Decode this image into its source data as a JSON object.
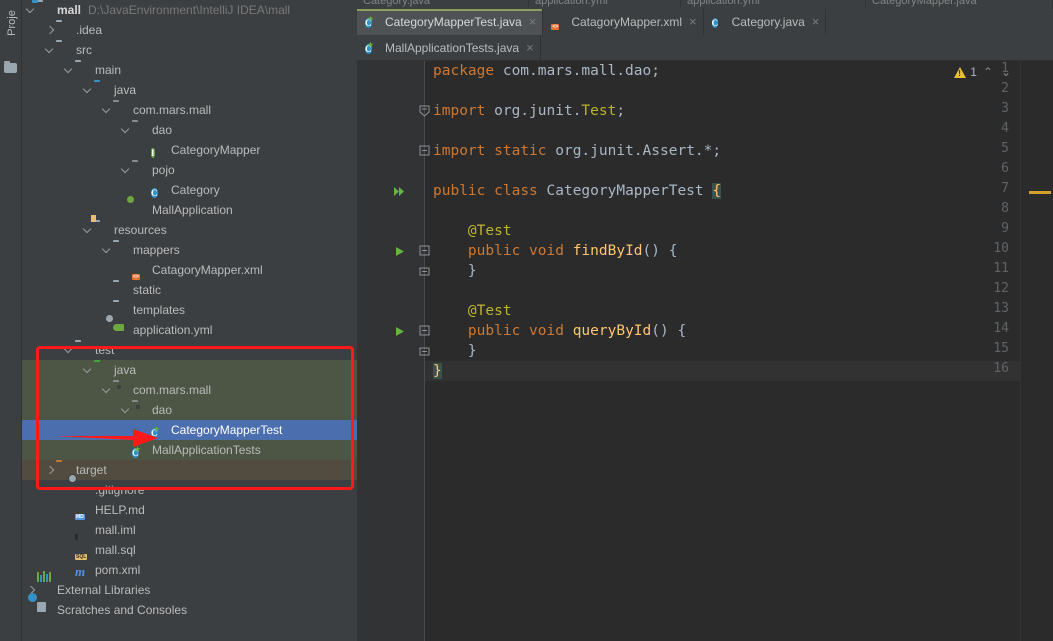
{
  "toolwindow": {
    "label": "Proje",
    "icon": "project-folder-icon"
  },
  "project_tree": {
    "rows": [
      {
        "indent": 0,
        "arrow": "expanded",
        "icon": "module-folder-icon",
        "label": "mall",
        "bold": true,
        "path": "D:\\JavaEnvironment\\IntelliJ IDEA\\mall"
      },
      {
        "indent": 1,
        "arrow": "collapsed",
        "icon": "folder-icon",
        "label": ".idea"
      },
      {
        "indent": 1,
        "arrow": "expanded",
        "icon": "folder-icon",
        "label": "src"
      },
      {
        "indent": 2,
        "arrow": "expanded",
        "icon": "folder-icon",
        "label": "main"
      },
      {
        "indent": 3,
        "arrow": "expanded",
        "icon": "source-folder-icon",
        "label": "java"
      },
      {
        "indent": 4,
        "arrow": "expanded",
        "icon": "package-icon",
        "label": "com.mars.mall"
      },
      {
        "indent": 5,
        "arrow": "expanded",
        "icon": "package-icon",
        "label": "dao"
      },
      {
        "indent": 6,
        "arrow": "none",
        "icon": "interface-icon",
        "label": "CategoryMapper"
      },
      {
        "indent": 5,
        "arrow": "expanded",
        "icon": "package-icon",
        "label": "pojo"
      },
      {
        "indent": 6,
        "arrow": "none",
        "icon": "class-icon",
        "label": "Category"
      },
      {
        "indent": 5,
        "arrow": "none",
        "icon": "spring-boot-icon",
        "label": "MallApplication"
      },
      {
        "indent": 3,
        "arrow": "expanded",
        "icon": "resources-folder-icon",
        "label": "resources"
      },
      {
        "indent": 4,
        "arrow": "expanded",
        "icon": "folder-icon",
        "label": "mappers"
      },
      {
        "indent": 5,
        "arrow": "none",
        "icon": "xml-file-icon",
        "label": "CatagoryMapper.xml"
      },
      {
        "indent": 4,
        "arrow": "none",
        "icon": "folder-icon",
        "label": "static"
      },
      {
        "indent": 4,
        "arrow": "none",
        "icon": "folder-icon",
        "label": "templates"
      },
      {
        "indent": 4,
        "arrow": "none",
        "icon": "yaml-file-icon",
        "label": "application.yml"
      },
      {
        "indent": 2,
        "arrow": "expanded",
        "icon": "folder-icon",
        "label": "test"
      },
      {
        "indent": 3,
        "arrow": "expanded",
        "icon": "test-source-folder-icon",
        "label": "java",
        "bg": "test-root"
      },
      {
        "indent": 4,
        "arrow": "expanded",
        "icon": "package-icon",
        "label": "com.mars.mall",
        "bg": "test-root"
      },
      {
        "indent": 5,
        "arrow": "expanded",
        "icon": "package-icon",
        "label": "dao",
        "bg": "test-root"
      },
      {
        "indent": 6,
        "arrow": "none",
        "icon": "test-class-icon",
        "label": "CategoryMapperTest",
        "bg": "selected"
      },
      {
        "indent": 5,
        "arrow": "none",
        "icon": "test-class-icon",
        "label": "MallApplicationTests",
        "bg": "test-root"
      },
      {
        "indent": 1,
        "arrow": "collapsed",
        "icon": "excluded-folder-icon",
        "label": "target",
        "bg": "excluded"
      },
      {
        "indent": 2,
        "arrow": "none",
        "icon": "gitignore-file-icon",
        "label": ".gitignore"
      },
      {
        "indent": 2,
        "arrow": "none",
        "icon": "markdown-file-icon",
        "label": "HELP.md",
        "tag": "MD"
      },
      {
        "indent": 2,
        "arrow": "none",
        "icon": "iml-file-icon",
        "label": "mall.iml"
      },
      {
        "indent": 2,
        "arrow": "none",
        "icon": "sql-file-icon",
        "label": "mall.sql",
        "tag": "SQL"
      },
      {
        "indent": 2,
        "arrow": "none",
        "icon": "maven-file-icon",
        "label": "pom.xml"
      },
      {
        "indent": 0,
        "arrow": "collapsed",
        "icon": "external-libraries-icon",
        "label": "External Libraries"
      },
      {
        "indent": 0,
        "arrow": "none",
        "icon": "scratches-icon",
        "label": "Scratches and Consoles"
      }
    ]
  },
  "annotation": {
    "box_color": "#ff1a1a",
    "arrow_color": "#ff1a1a",
    "highlighted_rows": [
      "test",
      "java",
      "com.mars.mall",
      "dao",
      "CategoryMapperTest",
      "MallApplicationTests",
      "target"
    ],
    "arrow_points_to": "CategoryMapperTest"
  },
  "editor": {
    "ghost_tabs": [
      {
        "label": "Category.java"
      },
      {
        "label": "application.yml"
      },
      {
        "label": "application.yml"
      },
      {
        "label": "CategoryMapper.java"
      }
    ],
    "tabs_row1": [
      {
        "label": "CategoryMapperTest.java",
        "icon": "test-class-icon",
        "active": true,
        "close": "×"
      },
      {
        "label": "CatagoryMapper.xml",
        "icon": "xml-file-icon",
        "active": false,
        "close": "×"
      },
      {
        "label": "Category.java",
        "icon": "class-icon",
        "active": false,
        "close": "×"
      }
    ],
    "tabs_row2": [
      {
        "label": "MallApplicationTests.java",
        "icon": "test-class-icon",
        "active": false,
        "close": "×"
      }
    ],
    "inspection": {
      "warning_icon": "warning-triangle-icon",
      "warning_count": "1",
      "up": "⌃",
      "down": "⌄"
    },
    "lines": [
      {
        "n": "1",
        "runmark": "",
        "fold": "",
        "text": "package com.mars.mall.dao;"
      },
      {
        "n": "2",
        "runmark": "",
        "fold": "",
        "text": ""
      },
      {
        "n": "3",
        "runmark": "",
        "fold": "+",
        "text": "import org.junit.Test;"
      },
      {
        "n": "4",
        "runmark": "",
        "fold": "",
        "text": ""
      },
      {
        "n": "5",
        "runmark": "",
        "fold": "-",
        "text": "import static org.junit.Assert.*;"
      },
      {
        "n": "6",
        "runmark": "",
        "fold": "",
        "text": ""
      },
      {
        "n": "7",
        "runmark": "run-all",
        "fold": "",
        "text": "public class CategoryMapperTest {"
      },
      {
        "n": "8",
        "runmark": "",
        "fold": "",
        "text": ""
      },
      {
        "n": "9",
        "runmark": "",
        "fold": "",
        "text": "    @Test"
      },
      {
        "n": "10",
        "runmark": "run",
        "fold": "-",
        "text": "    public void findById() {"
      },
      {
        "n": "11",
        "runmark": "",
        "fold": "^",
        "text": "    }"
      },
      {
        "n": "12",
        "runmark": "",
        "fold": "",
        "text": ""
      },
      {
        "n": "13",
        "runmark": "",
        "fold": "",
        "text": "    @Test"
      },
      {
        "n": "14",
        "runmark": "run",
        "fold": "-",
        "text": "    public void queryById() {"
      },
      {
        "n": "15",
        "runmark": "",
        "fold": "^",
        "text": "    }"
      },
      {
        "n": "16",
        "runmark": "",
        "fold": "",
        "text": "}"
      }
    ],
    "current_line": "16",
    "scroll_marker": {
      "type": "warning",
      "color": "#d1a32b"
    }
  },
  "colors": {
    "editor_bg": "#2b2b2b",
    "gutter_bg": "#313335",
    "panel_bg": "#3c3f41",
    "selection_blue": "#4b6eaf",
    "test_root_green": "#4d5545",
    "excluded_brown": "#514c3f",
    "keyword_orange": "#cc7832",
    "annotation_yellow": "#bbb529",
    "method_yellow": "#ffc66d",
    "text_default": "#a9b7c6"
  }
}
